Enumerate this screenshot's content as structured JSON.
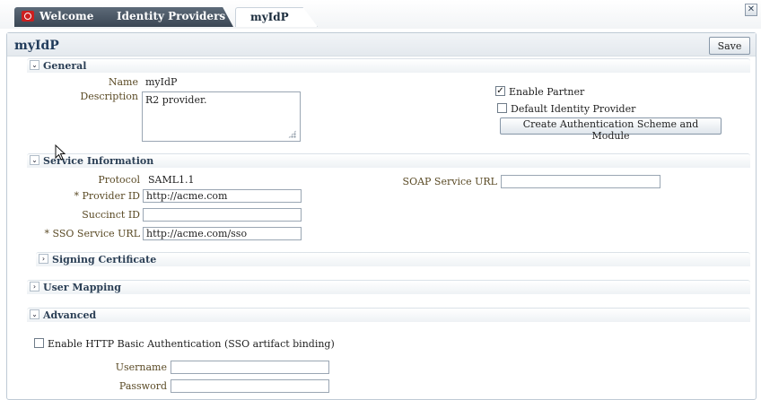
{
  "tabs": [
    {
      "label": "Welcome",
      "icon": "oracle-logo-icon"
    },
    {
      "label": "Identity Providers"
    },
    {
      "label": "myIdP",
      "active": true
    }
  ],
  "close_icon": "close-icon",
  "page": {
    "title": "myIdP",
    "save_label": "Save"
  },
  "general": {
    "title": "General",
    "name_label": "Name",
    "name_value": "myIdP",
    "description_label": "Description",
    "description_value": "R2 provider.",
    "enable_partner_label": "Enable Partner",
    "enable_partner_checked": true,
    "default_idp_label": "Default Identity Provider",
    "default_idp_checked": false,
    "create_auth_button": "Create Authentication Scheme and Module"
  },
  "service": {
    "title": "Service Information",
    "protocol_label": "Protocol",
    "protocol_value": "SAML1.1",
    "provider_id_label": "* Provider ID",
    "provider_id_value": "http://acme.com",
    "succinct_id_label": "Succinct ID",
    "succinct_id_value": "",
    "sso_url_label": "* SSO Service URL",
    "sso_url_value": "http://acme.com/sso",
    "soap_url_label": "SOAP Service URL",
    "soap_url_value": ""
  },
  "signing": {
    "title": "Signing Certificate"
  },
  "user_mapping": {
    "title": "User Mapping"
  },
  "advanced": {
    "title": "Advanced",
    "http_basic_label": "Enable HTTP Basic Authentication (SSO artifact binding)",
    "http_basic_checked": false,
    "username_label": "Username",
    "username_value": "",
    "password_label": "Password",
    "password_value": ""
  },
  "colors": {
    "tab_dark": "#3a4654",
    "label_text": "#5a4a25",
    "title_text": "#1f3a5a"
  }
}
